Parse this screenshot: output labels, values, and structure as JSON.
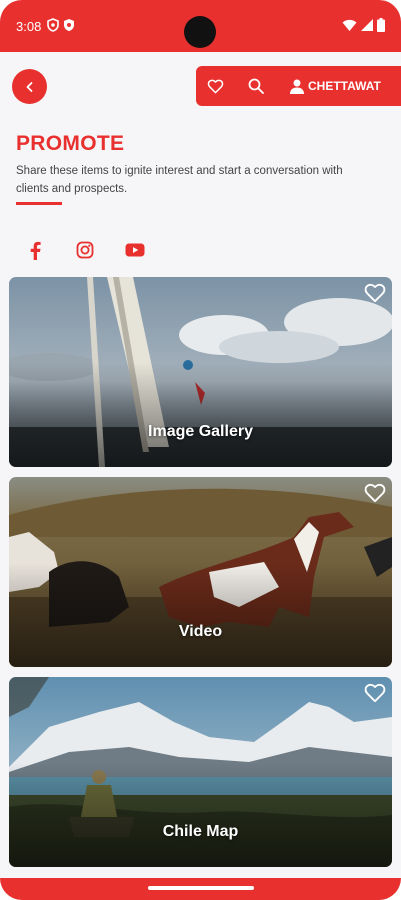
{
  "status_bar": {
    "time": "3:08",
    "color": "#e8312f"
  },
  "header": {
    "user_name": "CHETTAWAT"
  },
  "page": {
    "title": "PROMOTE",
    "subtitle": "Share these items to ignite interest and start a conversation with clients and prospects."
  },
  "social": [
    {
      "icon": "facebook-icon"
    },
    {
      "icon": "instagram-icon"
    },
    {
      "icon": "youtube-icon"
    }
  ],
  "cards": [
    {
      "label": "Image Gallery"
    },
    {
      "label": "Video"
    },
    {
      "label": "Chile Map"
    }
  ],
  "colors": {
    "accent": "#e8312f",
    "background": "#f6f6f9"
  }
}
